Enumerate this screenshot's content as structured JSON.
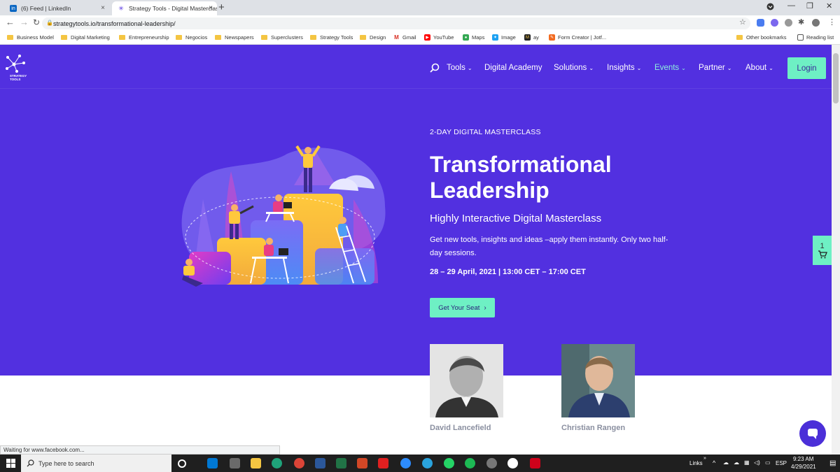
{
  "browser": {
    "tabs": [
      {
        "title": "(6) Feed | LinkedIn",
        "active": false
      },
      {
        "title": "Strategy Tools - Digital Masterclass",
        "active": true
      }
    ],
    "url": "strategytools.io/transformational-leadership/",
    "bookmarks": [
      "Business Model",
      "Digital Marketing",
      "Entrepreneurship",
      "Negocios",
      "Newspapers",
      "Superclusters",
      "Strategy Tools",
      "Design",
      "Gmail",
      "YouTube",
      "Maps",
      "Image",
      "ay",
      "Form Creator | Jotf...",
      "Other bookmarks",
      "Reading list"
    ],
    "status": "Waiting for www.facebook.com..."
  },
  "site": {
    "logo_text": "STRATEGY TOOLS",
    "nav": {
      "tools": "Tools",
      "academy": "Digital Academy",
      "solutions": "Solutions",
      "insights": "Insights",
      "events": "Events",
      "partner": "Partner",
      "about": "About",
      "login": "Login"
    },
    "hero": {
      "eyebrow": "2-DAY DIGITAL MASTERCLASS",
      "title": "Transformational Leadership",
      "subtitle": "Highly Interactive Digital Masterclass",
      "description": "Get new tools, insights and ideas –apply them instantly. Only two half-day sessions.",
      "dates": "28 – 29 April, 2021 | 13:00 CET – 17:00 CET",
      "cta": "Get Your Seat"
    },
    "speakers": [
      {
        "name": "David Lancefield"
      },
      {
        "name": "Christian Rangen"
      }
    ],
    "cart_count": "1",
    "colors": {
      "hero_bg": "#5230e0",
      "accent": "#6ef0c4",
      "nav_active": "#8ef0dd"
    }
  },
  "taskbar": {
    "search_placeholder": "Type here to search",
    "links_label": "Links",
    "language": "ESP",
    "time": "9:23 AM",
    "date": "4/29/2021"
  }
}
